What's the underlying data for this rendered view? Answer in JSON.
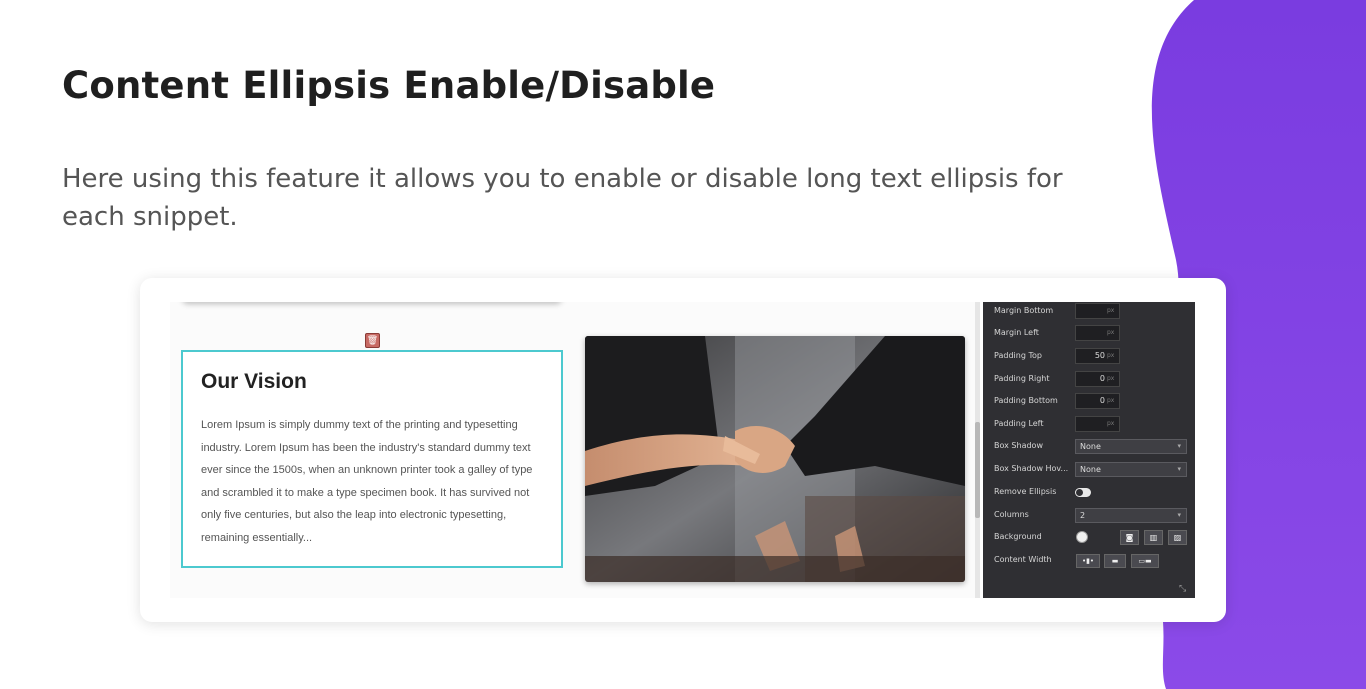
{
  "heading": "Content Ellipsis Enable/Disable",
  "description": "Here using this feature it allows you to enable or disable long text ellipsis for each snippet.",
  "editor": {
    "card": {
      "title": "Our Vision",
      "text": "Lorem Ipsum is simply dummy text of the printing and typesetting industry. Lorem Ipsum has been the industry's standard dummy text ever since the 1500s, when an unknown printer took a galley of type and scrambled it to make a type specimen book. It has survived not only five centuries, but also the leap into electronic typesetting, remaining essentially..."
    },
    "panel": {
      "unit": "px",
      "margin_bottom": {
        "label": "Margin Bottom",
        "value": ""
      },
      "margin_left": {
        "label": "Margin Left",
        "value": ""
      },
      "padding_top": {
        "label": "Padding Top",
        "value": "50"
      },
      "padding_right": {
        "label": "Padding Right",
        "value": "0"
      },
      "padding_bottom": {
        "label": "Padding Bottom",
        "value": "0"
      },
      "padding_left": {
        "label": "Padding Left",
        "value": ""
      },
      "box_shadow": {
        "label": "Box Shadow",
        "value": "None"
      },
      "box_shadow_hover": {
        "label": "Box Shadow Hov...",
        "value": "None"
      },
      "remove_ellipsis": {
        "label": "Remove Ellipsis",
        "enabled": true
      },
      "columns": {
        "label": "Columns",
        "value": "2"
      },
      "background": {
        "label": "Background"
      },
      "content_width": {
        "label": "Content Width"
      }
    }
  },
  "colors": {
    "accent_purple": "#7b3fe4",
    "selection_border": "#4cc9cf",
    "panel_bg": "#2f2f33"
  }
}
